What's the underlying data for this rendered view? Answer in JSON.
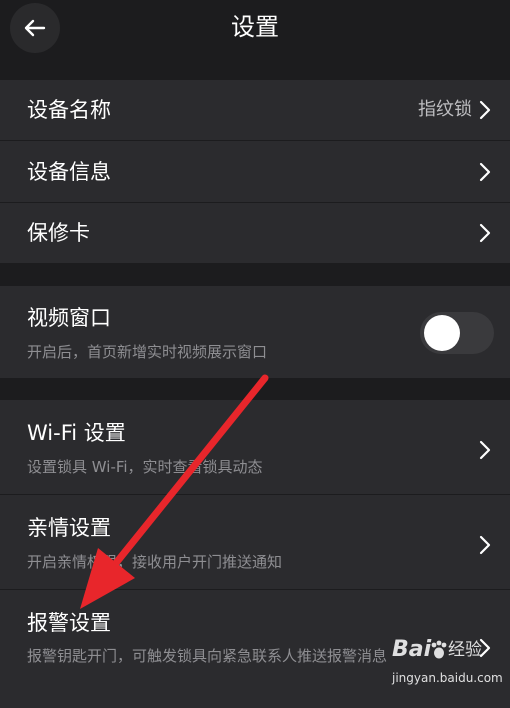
{
  "header": {
    "title": "设置"
  },
  "group1": {
    "device_name": {
      "title": "设备名称",
      "value": "指纹锁"
    },
    "device_info": {
      "title": "设备信息"
    },
    "warranty_card": {
      "title": "保修卡"
    }
  },
  "group2": {
    "video_window": {
      "title": "视频窗口",
      "subtitle": "开启后，首页新增实时视频展示窗口",
      "enabled": false
    }
  },
  "group3": {
    "wifi": {
      "title": "Wi-Fi 设置",
      "subtitle": "设置锁具 Wi-Fi，实时查看锁具动态"
    },
    "family": {
      "title": "亲情设置",
      "subtitle": "开启亲情权限，接收用户开门推送通知"
    },
    "alarm": {
      "title": "报警设置",
      "subtitle": "报警钥匙开门，可触发锁具向紧急联系人推送报警消息"
    }
  },
  "watermark": {
    "brand": "Bai",
    "label": "经验",
    "url": "jingyan.baidu.com"
  },
  "colors": {
    "background": "#1c1c1e",
    "card": "#2b2b2e",
    "annotation_arrow": "#e8262b"
  },
  "icons": {
    "back": "arrow-left-icon",
    "chevron": "chevron-right-icon"
  }
}
